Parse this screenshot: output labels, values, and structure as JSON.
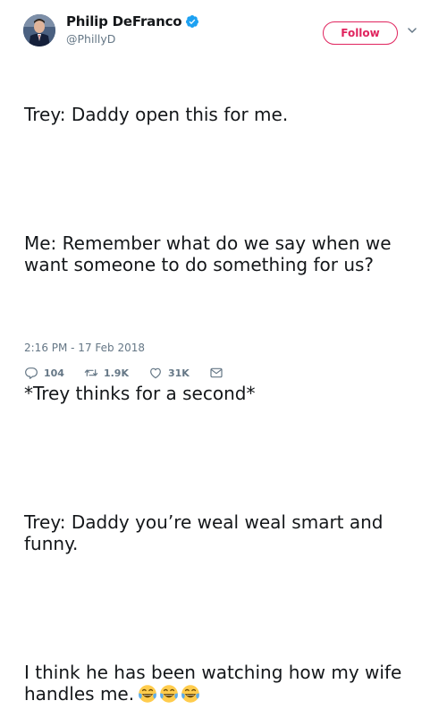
{
  "user": {
    "display_name": "Philip DeFranco",
    "handle": "@PhillyD",
    "verified": true
  },
  "follow_button": {
    "label": "Follow"
  },
  "tweet": {
    "paragraphs": [
      "Trey: Daddy open this for me.",
      "Me: Remember what do we say when we want someone to do something for us?",
      "*Trey thinks for a second*",
      "Trey: Daddy you’re weal weal smart and funny.",
      "I think he has been watching how my wife handles me."
    ],
    "emoji": [
      "face-with-tears-of-joy",
      "face-with-tears-of-joy",
      "face-with-tears-of-joy"
    ]
  },
  "timestamp": "2:16 PM - 17 Feb 2018",
  "actions": {
    "reply_count": "104",
    "retweet_count": "1.9K",
    "like_count": "31K"
  },
  "colors": {
    "accent": "#e0245e",
    "verified": "#1da1f2",
    "muted": "#657786",
    "text": "#14171a"
  }
}
